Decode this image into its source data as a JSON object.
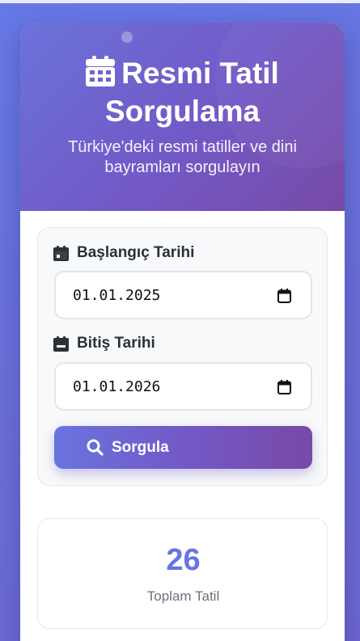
{
  "header": {
    "title": "Resmi Tatil Sorgulama",
    "title_icon": "calendar-grid-icon",
    "subtitle": "Türkiye'deki resmi tatiller ve dini bayramları sorgulayın"
  },
  "form": {
    "start": {
      "label": "Başlangıç Tarihi",
      "icon": "calendar-icon",
      "value": "01.01.2025"
    },
    "end": {
      "label": "Bitiş Tarihi",
      "icon": "calendar-minus-icon",
      "value": "01.01.2026"
    },
    "submit": {
      "label": "Sorgula",
      "icon": "search-icon"
    }
  },
  "stats": {
    "total": "26",
    "label": "Toplam Tatil"
  },
  "colors": {
    "background": "#6a6fd8",
    "header_start": "#6b72da",
    "header_end": "#784aa6",
    "accent": "#6676e3",
    "form_bg": "#f8f9fa"
  }
}
